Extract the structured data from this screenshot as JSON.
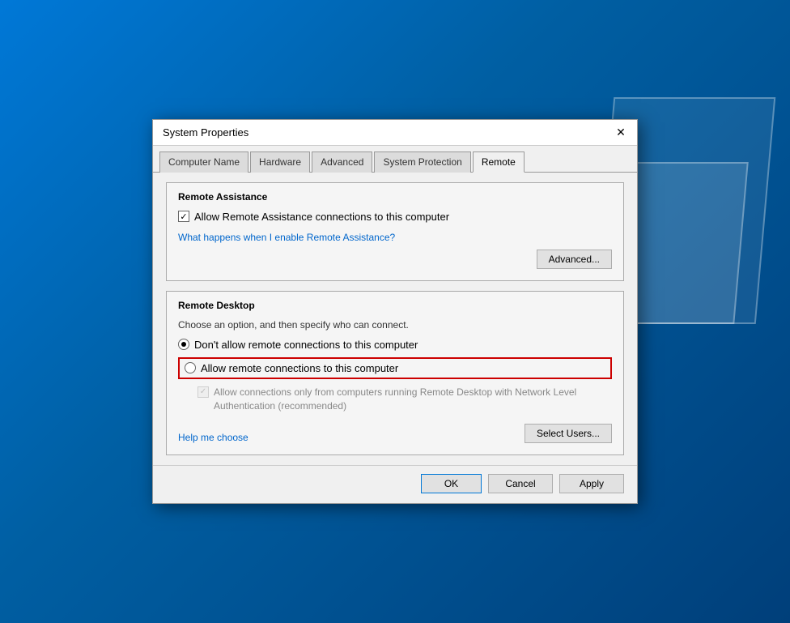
{
  "background": {
    "color_start": "#0078d7",
    "color_end": "#003f7a"
  },
  "dialog": {
    "title": "System Properties",
    "close_label": "✕",
    "tabs": [
      {
        "label": "Computer Name",
        "active": false
      },
      {
        "label": "Hardware",
        "active": false
      },
      {
        "label": "Advanced",
        "active": false
      },
      {
        "label": "System Protection",
        "active": false
      },
      {
        "label": "Remote",
        "active": true
      }
    ],
    "remote_assistance": {
      "section_title": "Remote Assistance",
      "checkbox_label": "Allow Remote Assistance connections to this computer",
      "checkbox_checked": true,
      "link_text": "What happens when I enable Remote Assistance?",
      "advanced_btn": "Advanced..."
    },
    "remote_desktop": {
      "section_title": "Remote Desktop",
      "desc": "Choose an option, and then specify who can connect.",
      "radio_options": [
        {
          "label": "Don't allow remote connections to this computer",
          "selected": true
        },
        {
          "label": "Allow remote connections to this computer",
          "selected": false,
          "highlighted": true
        }
      ],
      "sub_checkbox_label": "Allow connections only from computers running Remote Desktop with Network Level Authentication (recommended)",
      "sub_checkbox_checked": true,
      "help_link": "Help me choose",
      "select_users_btn": "Select Users..."
    },
    "buttons": {
      "ok": "OK",
      "cancel": "Cancel",
      "apply": "Apply"
    }
  }
}
